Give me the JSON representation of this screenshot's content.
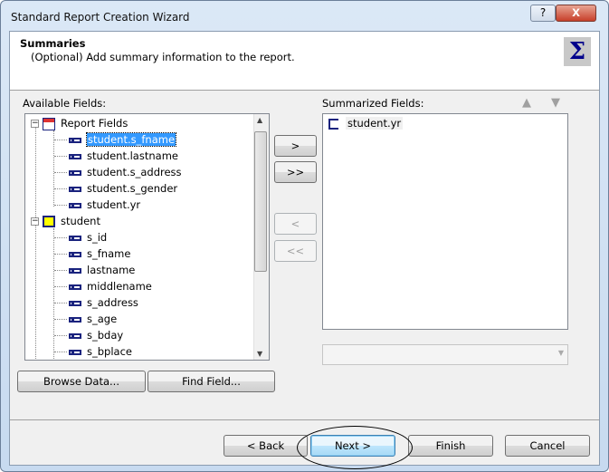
{
  "window": {
    "title": "Standard Report Creation Wizard",
    "help_label": "?",
    "close_label": "X"
  },
  "header": {
    "title": "Summaries",
    "subtitle": "(Optional) Add summary information to the report.",
    "icon": "sigma-icon",
    "icon_glyph": "Σ"
  },
  "available": {
    "label": "Available Fields:",
    "groups": [
      {
        "label": "Report Fields",
        "expander": "−",
        "items": [
          "student.s_fname",
          "student.lastname",
          "student.s_address",
          "student.s_gender",
          "student.yr"
        ],
        "selected": "student.s_fname"
      },
      {
        "label": "student",
        "expander": "−",
        "items": [
          "s_id",
          "s_fname",
          "lastname",
          "middlename",
          "s_address",
          "s_age",
          "s_bday",
          "s_bplace"
        ]
      }
    ]
  },
  "move_buttons": {
    "add": ">",
    "add_all": ">>",
    "remove": "<",
    "remove_all": "<<"
  },
  "summarized": {
    "label": "Summarized Fields:",
    "items": [
      "student.yr"
    ],
    "combo_value": ""
  },
  "buttons": {
    "browse": "Browse Data...",
    "find": "Find Field...",
    "back": "< Back",
    "next": "Next >",
    "finish": "Finish",
    "cancel": "Cancel"
  }
}
